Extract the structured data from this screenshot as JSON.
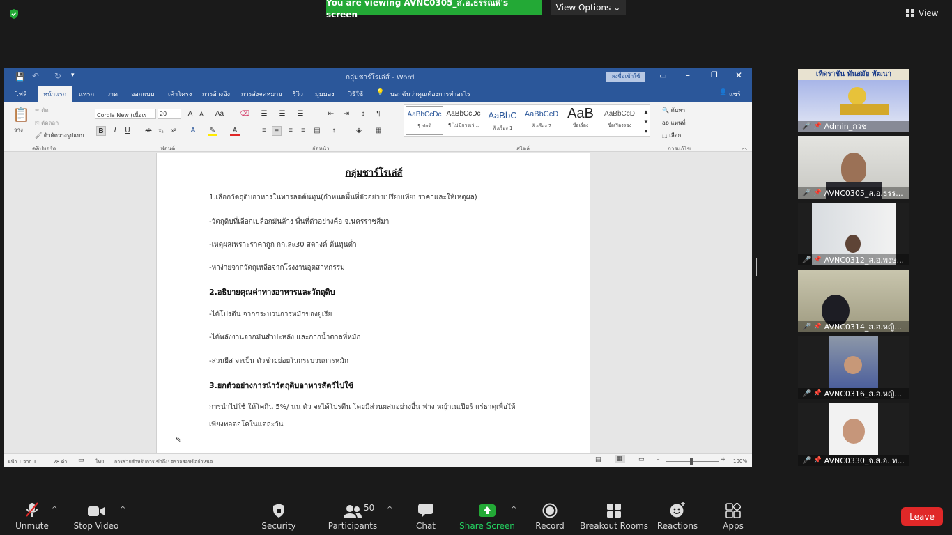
{
  "zoom": {
    "banner": "You are viewing AVNC0305_ส.อ.ธรรณพิ's screen",
    "view_options": "View Options",
    "view": "View",
    "accent": "#23a936"
  },
  "word": {
    "title": "กลุ่มชาร์โรเล่ส์ - Word",
    "signin": "ลงชื่อเข้าใช้",
    "tabs": [
      "ไฟล์",
      "หน้าแรก",
      "แทรก",
      "วาด",
      "ออกแบบ",
      "เค้าโครง",
      "การอ้างอิง",
      "การส่งจดหมาย",
      "รีวิว",
      "มุมมอง",
      "วิธีใช้"
    ],
    "tell_me": "บอกฉันว่าคุณต้องการทำอะไร",
    "share": "แชร์",
    "font_name": "Cordia New (เนื้อเร",
    "font_size": "20",
    "clipboard": [
      "วาง",
      "ตัด",
      "คัดลอก",
      "ตัวคัดวางรูปแบบ"
    ],
    "group_labels": [
      "คลิปบอร์ด",
      "ฟอนต์",
      "ย่อหน้า",
      "สไตล์",
      "การแก้ไข"
    ],
    "styles": [
      {
        "preview": "AaBbCcDc",
        "name": "¶ ปกติ"
      },
      {
        "preview": "AaBbCcDc",
        "name": "¶ ไม่มีการเว้..."
      },
      {
        "preview": "AaBbC",
        "name": "หัวเรื่อง 1"
      },
      {
        "preview": "AaBbCcD",
        "name": "หัวเรื่อง 2"
      },
      {
        "preview": "AaB",
        "name": "ชื่อเรื่อง"
      },
      {
        "preview": "AaBbCcD",
        "name": "ชื่อเรื่องรอง"
      }
    ],
    "editing": [
      "ค้นหา",
      "แทนที่",
      "เลือก"
    ],
    "document": {
      "title": "กลุ่มชาร์โรเล่ส์",
      "lines": [
        "1.เลือกวัตถุดิบอาหารในทารลดต้นทุน(กำหนดพื้นที่ตัวอย่างเปรียบเทียบราคาและให้เหตุผล)",
        "-วัตถุดิบที่เลือกเปลือกมันล้าง  พื้นที่ตัวอย่างคือ จ.นครราชสีมา",
        "-เหตุผลเพราะราคาถูก กก.ละ30 สตางค์ ต้นทุนต่ำ",
        "-หาง่ายจากวัตถุเหลือจากโรงงานอุตสาหกรรม",
        "2.อธิบายคุณค่าทางอาหารและวัตถุดิบ",
        "-ได้โปรตีน จากกระบวนการหมักของยูเรีย",
        "-ได้พลังงานจากมันสำปะหลัง และกากน้ำตาลที่หมัก",
        "-ส่วนยีส จะเป็น ตัวช่วยย่อยในกระบวนการหมัก",
        "3.ยกตัวอย่างการนำวัตถุดิบอาหารสัตว์ไปใช้",
        "การนำไปใช้  ให้โคกิน 5%/ นน ตัว จะได้โปรตีน โดยมีส่วนผสมอย่างอื่น ฟาง หญ้าเนเปียร์ แร่ธาตุเพื่อให้",
        "เพียงพอต่อโคในแต่ละวัน"
      ]
    },
    "status": {
      "page": "หน้า 1 จาก 1",
      "words": "128 คำ",
      "lang": "ไทย",
      "accessibility": "การช่วยสำหรับการเข้าถึง: ตรวจสอบข้อกำหนด",
      "zoom": "100%"
    }
  },
  "participants": [
    {
      "name": "Admin_กวช",
      "header": "เทิดราชัน  ทันสมัย  พัฒนา"
    },
    {
      "name": "AVNC0305_ส.อ.ธรร..."
    },
    {
      "name": "AVNC0312_ส.อ.พงษ..."
    },
    {
      "name": "AVNC0314_ส.อ.หญิ..."
    },
    {
      "name": "AVNC0316_ส.อ.หญิ..."
    },
    {
      "name": "AVNC0330_จ.ส.อ. ท..."
    }
  ],
  "toolbar": {
    "unmute": "Unmute",
    "stop_video": "Stop Video",
    "security": "Security",
    "participants": "Participants",
    "participants_count": "50",
    "chat": "Chat",
    "share_screen": "Share Screen",
    "record": "Record",
    "breakout_rooms": "Breakout Rooms",
    "reactions": "Reactions",
    "apps": "Apps",
    "leave": "Leave",
    "leave_color": "#e02828"
  }
}
